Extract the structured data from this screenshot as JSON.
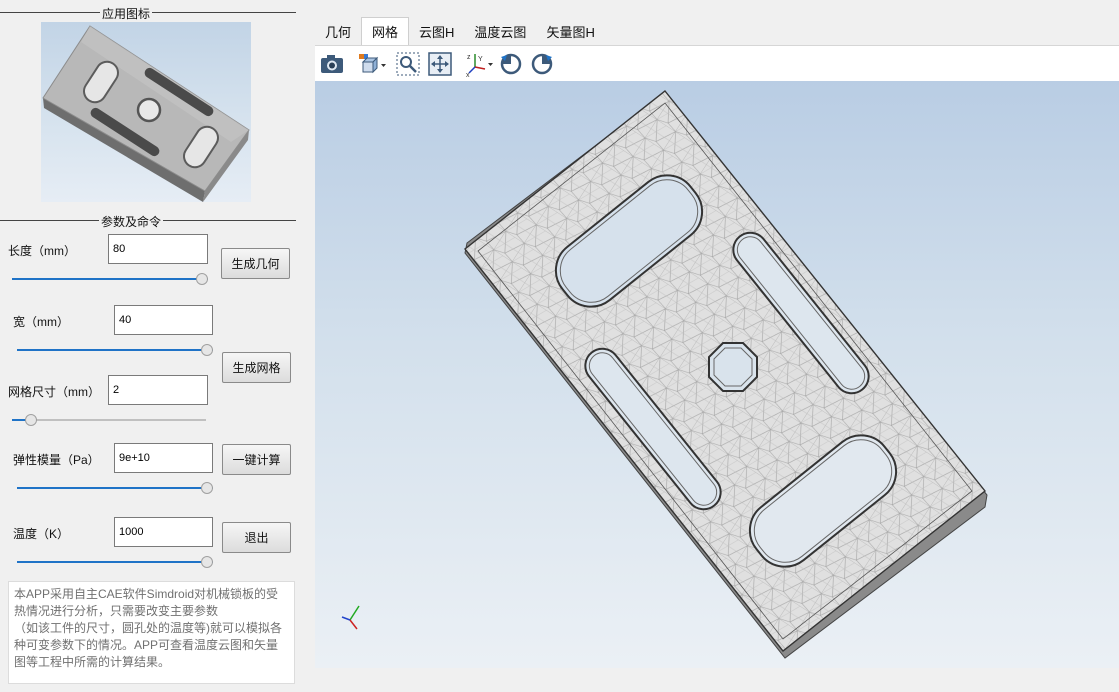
{
  "left_panel": {
    "icon_section_title": "应用图标",
    "params_section_title": "参数及命令",
    "params": {
      "length": {
        "label": "长度（mm）",
        "value": "80",
        "slider_fraction": 1.0
      },
      "width": {
        "label": "宽（mm）",
        "value": "40",
        "slider_fraction": 1.0
      },
      "mesh_size": {
        "label": "网格尺寸（mm）",
        "value": "2",
        "slider_fraction": 0.07
      },
      "elastic_modulus": {
        "label": "弹性模量（Pa）",
        "value": "9e+10",
        "slider_fraction": 1.0
      },
      "temperature": {
        "label": "温度（K）",
        "value": "1000",
        "slider_fraction": 1.0
      }
    },
    "buttons": {
      "generate_geometry": "生成几何",
      "generate_mesh": "生成网格",
      "compute": "一键计算",
      "exit": "退出"
    },
    "description": "本APP采用自主CAE软件Simdroid对机械锁板的受热情况进行分析，只需要改变主要参数\n（如该工件的尺寸，圆孔处的温度等)就可以模拟各种可变参数下的情况。APP可查看温度云图和矢量图等工程中所需的计算结果。"
  },
  "tabs": [
    {
      "label": "几何",
      "active": false
    },
    {
      "label": "网格",
      "active": true
    },
    {
      "label": "云图H",
      "active": false
    },
    {
      "label": "温度云图",
      "active": false
    },
    {
      "label": "矢量图H",
      "active": false
    }
  ],
  "toolbar": {
    "icons": [
      "camera-icon",
      "view-cube-dropdown-icon",
      "zoom-fit-icon",
      "zoom-extents-icon",
      "axes-dropdown-icon",
      "rotate-left-icon",
      "rotate-right-icon"
    ]
  },
  "colors": {
    "accent": "#1f73c7",
    "viewport_top": "#b9cde4",
    "viewport_bottom": "#ebf0f5",
    "mesh_fill": "#e2e2e2",
    "mesh_lines": "#9a9a9a"
  }
}
